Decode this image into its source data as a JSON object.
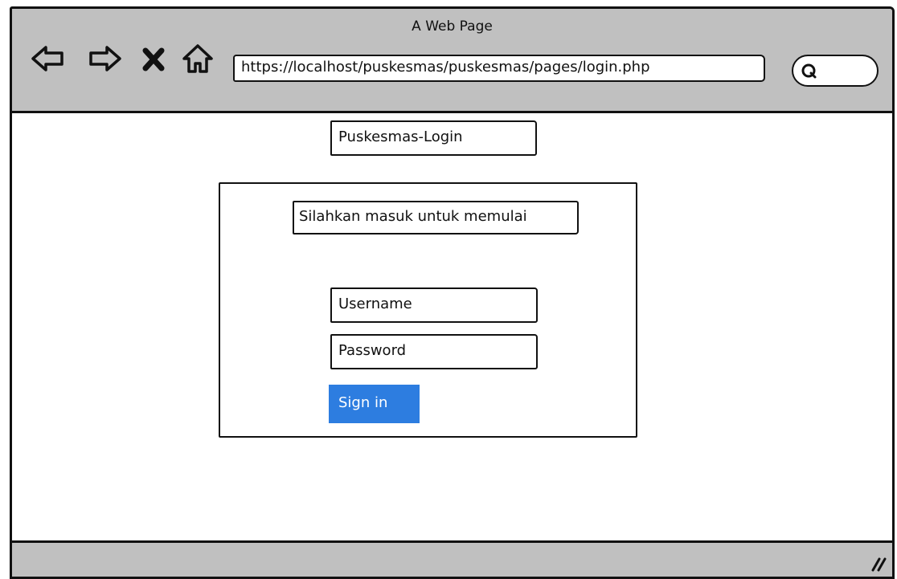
{
  "window": {
    "title": "A Web Page"
  },
  "toolbar": {
    "url": "https://localhost/puskesmas/puskesmas/pages/login.php",
    "icons": [
      "back-arrow-icon",
      "forward-arrow-icon",
      "close-icon",
      "home-icon",
      "search-icon"
    ]
  },
  "main": {
    "app_title": "Puskesmas-Login",
    "panel_heading": "Silahkan masuk untuk memulai",
    "username_label": "Username",
    "password_label": "Password",
    "signin_label": "Sign in"
  },
  "colors": {
    "chrome": "#c0c0c0",
    "accent": "#2d7de0",
    "ink": "#111111"
  }
}
